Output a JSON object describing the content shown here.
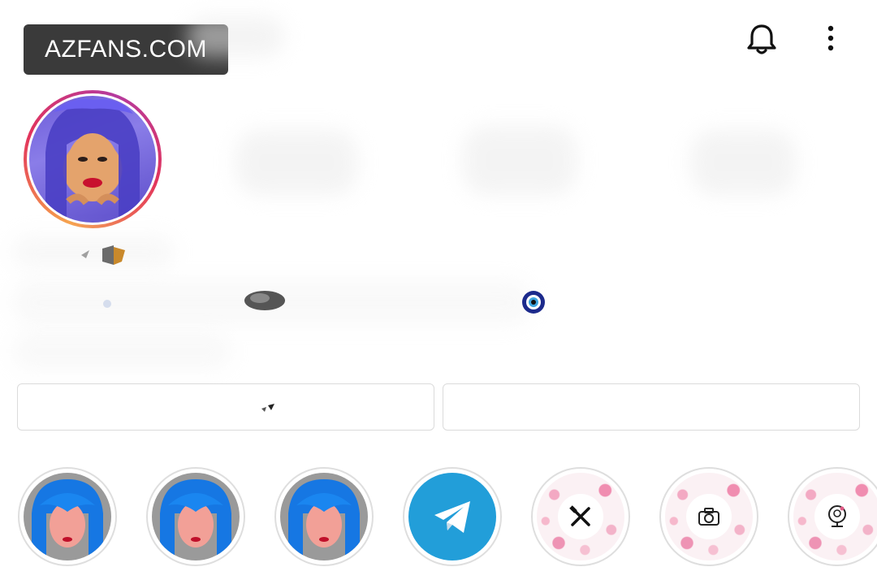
{
  "watermark": {
    "text": "AZFANS.COM"
  },
  "header": {
    "icons": [
      "bell-icon",
      "more-vertical-icon"
    ]
  },
  "profile": {
    "avatar_icon": "profile-avatar"
  },
  "buttons": [
    {
      "name": "follow-button",
      "label": ""
    },
    {
      "name": "message-button",
      "label": ""
    }
  ],
  "highlights": [
    {
      "type": "photo",
      "label": ""
    },
    {
      "type": "photo",
      "label": ""
    },
    {
      "type": "photo",
      "label": ""
    },
    {
      "type": "telegram",
      "label": "",
      "icon": "telegram-icon"
    },
    {
      "type": "floral",
      "label": "",
      "icon": "fork-knife-icon"
    },
    {
      "type": "floral",
      "label": "",
      "icon": "camera-icon"
    },
    {
      "type": "floral",
      "label": "",
      "icon": "woman-mirror-icon"
    }
  ],
  "colors": {
    "ring_start": "#f6a24b",
    "ring_mid": "#e2345c",
    "telegram": "#229ed9",
    "border": "#dbdbdb"
  }
}
